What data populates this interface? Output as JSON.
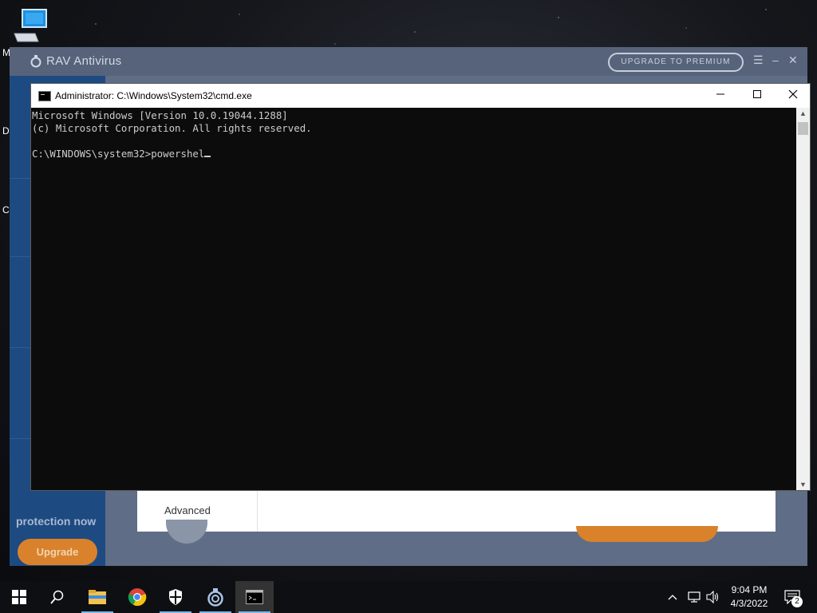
{
  "desktop": {
    "icons": [
      {
        "name": "This PC"
      }
    ],
    "edge_letters": [
      "M",
      "D",
      "C"
    ]
  },
  "rav": {
    "logo_text": "RAV Antivirus",
    "upgrade_premium_label": "UPGRADE TO PREMIUM",
    "protection_text": "protection now",
    "upgrade_label": "Upgrade",
    "advanced_label": "Advanced"
  },
  "cmd": {
    "title": "Administrator: C:\\Windows\\System32\\cmd.exe",
    "lines": [
      "Microsoft Windows [Version 10.0.19044.1288]",
      "(c) Microsoft Corporation. All rights reserved.",
      "",
      "C:\\WINDOWS\\system32>powershel"
    ],
    "minimize_icon": "minimize-icon",
    "maximize_icon": "maximize-icon",
    "close_icon": "close-icon"
  },
  "taskbar": {
    "apps": [
      "start",
      "search",
      "file-explorer",
      "chrome",
      "windows-security",
      "rav-antivirus",
      "cmd"
    ],
    "time": "9:04 PM",
    "date": "4/3/2022",
    "notification_count": "2",
    "accent": "#76b9ed"
  }
}
